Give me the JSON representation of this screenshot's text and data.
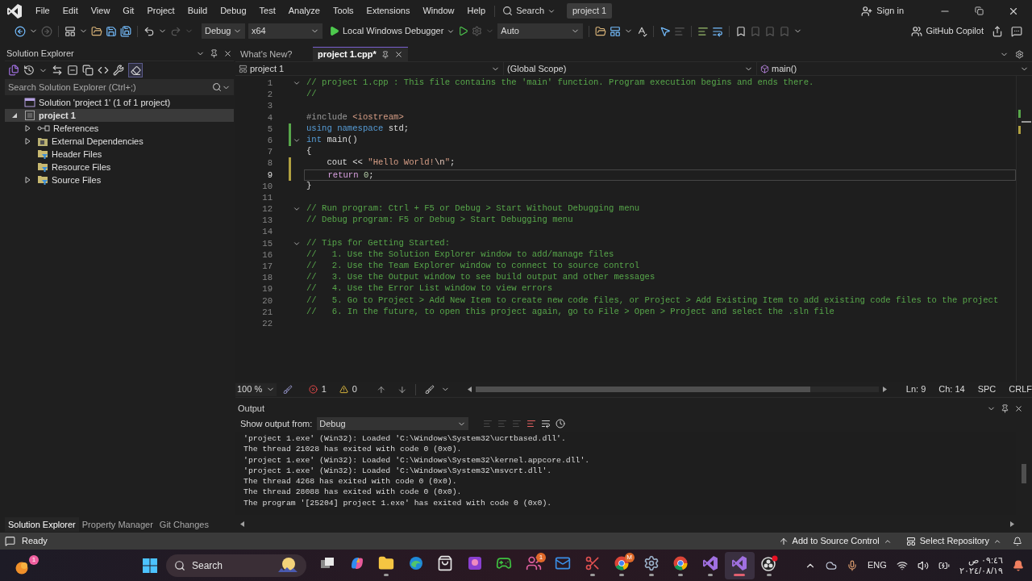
{
  "menu_bar": {
    "items": [
      "File",
      "Edit",
      "View",
      "Git",
      "Project",
      "Build",
      "Debug",
      "Test",
      "Analyze",
      "Tools",
      "Extensions",
      "Window",
      "Help"
    ],
    "search": "Search",
    "solution_name": "project 1",
    "sign_in": "Sign in"
  },
  "toolbar": {
    "configuration": "Debug",
    "platform": "x64",
    "debugger": "Local Windows Debugger",
    "target": "Auto",
    "copilot": "GitHub Copilot"
  },
  "solution_explorer": {
    "title": "Solution Explorer",
    "search_placeholder": "Search Solution Explorer (Ctrl+;)",
    "tree": [
      {
        "label": "Solution 'project 1' (1 of 1 project)",
        "kind": "solution",
        "selected": false,
        "children": [
          {
            "label": "project 1",
            "kind": "project",
            "expanded": true,
            "selected": true,
            "children": [
              {
                "label": "References",
                "kind": "references",
                "expanded": false,
                "selected": false
              },
              {
                "label": "External Dependencies",
                "kind": "dependencies",
                "expanded": false,
                "selected": false
              },
              {
                "label": "Header Files",
                "kind": "filter",
                "selected": false
              },
              {
                "label": "Resource Files",
                "kind": "filter",
                "selected": false
              },
              {
                "label": "Source Files",
                "kind": "filter",
                "expanded": false,
                "selected": false
              }
            ]
          }
        ]
      }
    ]
  },
  "left_tabs": [
    {
      "label": "Solution Explorer",
      "selected": true
    },
    {
      "label": "Property Manager",
      "selected": false
    },
    {
      "label": "Git Changes",
      "selected": false
    }
  ],
  "editor": {
    "tabs": [
      {
        "label": "What's New?",
        "selected": false
      },
      {
        "label": "project 1.cpp*",
        "selected": true
      }
    ],
    "nav": {
      "project": "project 1",
      "scope": "(Global Scope)",
      "member": "main()"
    },
    "lines": [
      {
        "number": "1",
        "fold": true,
        "current": false,
        "tokens": [
          {
            "kind": "comment",
            "text": "// project 1.cpp : This file contains the 'main' function. Program execution begins and ends there."
          }
        ]
      },
      {
        "number": "2",
        "fold": false,
        "current": false,
        "tokens": [
          {
            "kind": "comment",
            "text": "//"
          }
        ]
      },
      {
        "number": "3",
        "fold": false,
        "current": false
      },
      {
        "number": "4",
        "fold": false,
        "current": false,
        "tokens": [
          {
            "kind": "preproc",
            "text": "#include"
          },
          {
            "kind": "header",
            "text": " <iostream>"
          }
        ]
      },
      {
        "number": "5",
        "fold": false,
        "current": false,
        "modified": true,
        "saved": true,
        "tokens": [
          {
            "kind": "keyword",
            "text": "using"
          },
          {
            "kind": "keyword",
            "text": " namespace"
          },
          {
            "kind": "plain",
            "text": " std;"
          }
        ]
      },
      {
        "number": "6",
        "fold": true,
        "current": false,
        "modified": true,
        "saved": true,
        "tokens": [
          {
            "kind": "keyword",
            "text": "int"
          },
          {
            "kind": "plain",
            "text": " main()"
          }
        ]
      },
      {
        "number": "7",
        "fold": false,
        "current": false,
        "tokens": [
          {
            "kind": "plain",
            "text": "{"
          }
        ]
      },
      {
        "number": "8",
        "fold": false,
        "current": false,
        "modified": true,
        "saved": false,
        "tokens": [
          {
            "kind": "plain",
            "text": "    cout << "
          },
          {
            "kind": "string",
            "text": "\"Hello World!"
          },
          {
            "kind": "escape",
            "text": "\\n"
          },
          {
            "kind": "string",
            "text": "\""
          },
          {
            "kind": "plain",
            "text": ";"
          }
        ]
      },
      {
        "number": "9",
        "fold": false,
        "current": true,
        "modified": true,
        "saved": false,
        "tokens": [
          {
            "kind": "control",
            "text": "    return"
          },
          {
            "kind": "number",
            "text": " 0"
          },
          {
            "kind": "plain",
            "text": ";"
          }
        ]
      },
      {
        "number": "10",
        "fold": false,
        "current": false,
        "tokens": [
          {
            "kind": "plain",
            "text": "}"
          }
        ]
      },
      {
        "number": "11",
        "fold": false,
        "current": false
      },
      {
        "number": "12",
        "fold": true,
        "current": false,
        "tokens": [
          {
            "kind": "comment",
            "text": "// Run program: Ctrl + F5 or Debug > Start Without Debugging menu"
          }
        ]
      },
      {
        "number": "13",
        "fold": false,
        "current": false,
        "tokens": [
          {
            "kind": "comment",
            "text": "// Debug program: F5 or Debug > Start Debugging menu"
          }
        ]
      },
      {
        "number": "14",
        "fold": false,
        "current": false
      },
      {
        "number": "15",
        "fold": true,
        "current": false,
        "tokens": [
          {
            "kind": "comment",
            "text": "// Tips for Getting Started:"
          }
        ]
      },
      {
        "number": "16",
        "fold": false,
        "current": false,
        "tokens": [
          {
            "kind": "comment",
            "text": "//   1. Use the Solution Explorer window to add/manage files"
          }
        ]
      },
      {
        "number": "17",
        "fold": false,
        "current": false,
        "tokens": [
          {
            "kind": "comment",
            "text": "//   2. Use the Team Explorer window to connect to source control"
          }
        ]
      },
      {
        "number": "18",
        "fold": false,
        "current": false,
        "tokens": [
          {
            "kind": "comment",
            "text": "//   3. Use the Output window to see build output and other messages"
          }
        ]
      },
      {
        "number": "19",
        "fold": false,
        "current": false,
        "tokens": [
          {
            "kind": "comment",
            "text": "//   4. Use the Error List window to view errors"
          }
        ]
      },
      {
        "number": "20",
        "fold": false,
        "current": false,
        "tokens": [
          {
            "kind": "comment",
            "text": "//   5. Go to Project > Add New Item to create new code files, or Project > Add Existing Item to add existing code files to the project"
          }
        ]
      },
      {
        "number": "21",
        "fold": false,
        "current": false,
        "tokens": [
          {
            "kind": "comment",
            "text": "//   6. In the future, to open this project again, go to File > Open > Project and select the .sln file"
          }
        ]
      },
      {
        "number": "22",
        "fold": false,
        "current": false
      }
    ],
    "status": {
      "zoom": "100 %",
      "errors": "1",
      "warnings": "0",
      "line": "Ln: 9",
      "column": "Ch: 14",
      "indent": "SPC",
      "line_ending": "CRLF"
    }
  },
  "output": {
    "title": "Output",
    "source_label": "Show output from:",
    "source": "Debug",
    "lines": [
      "'project 1.exe' (Win32): Loaded 'C:\\Windows\\System32\\ucrtbased.dll'.",
      "The thread 21028 has exited with code 0 (0x0).",
      "'project 1.exe' (Win32): Loaded 'C:\\Windows\\System32\\kernel.appcore.dll'.",
      "'project 1.exe' (Win32): Loaded 'C:\\Windows\\System32\\msvcrt.dll'.",
      "The thread 4268 has exited with code 0 (0x0).",
      "The thread 28088 has exited with code 0 (0x0).",
      "The program '[25204] project 1.exe' has exited with code 0 (0x0)."
    ]
  },
  "status_bar": {
    "message": "Ready",
    "source_control": "Add to Source Control",
    "repository": "Select Repository"
  },
  "taskbar": {
    "widget_badge": "1",
    "search": "Search",
    "apps": [
      {
        "kind": "taskview",
        "running": false,
        "selected": false
      },
      {
        "kind": "copilot",
        "running": false,
        "selected": false
      },
      {
        "kind": "explorer",
        "running": true,
        "selected": false
      },
      {
        "kind": "edge",
        "running": false,
        "selected": false
      },
      {
        "kind": "store",
        "running": false,
        "selected": false
      },
      {
        "kind": "photos",
        "running": false,
        "selected": false
      },
      {
        "kind": "xbox",
        "running": false,
        "selected": false
      },
      {
        "kind": "teams",
        "running": false,
        "selected": false,
        "badge": "1"
      },
      {
        "kind": "outlook",
        "running": false,
        "selected": false
      },
      {
        "kind": "snipping",
        "running": true,
        "selected": false
      },
      {
        "kind": "chrome",
        "running": true,
        "selected": false,
        "badge": "M"
      },
      {
        "kind": "settings",
        "running": true,
        "selected": false
      },
      {
        "kind": "chrome",
        "running": true,
        "selected": false
      },
      {
        "kind": "vs",
        "running": true,
        "selected": false
      },
      {
        "kind": "vs",
        "running": true,
        "selected": true
      },
      {
        "kind": "obs",
        "running": true,
        "selected": false
      }
    ],
    "language": "ENG",
    "time": "٠٩:٤٦ ص",
    "date": "٢٠٢٤/٠٨/١٩"
  }
}
